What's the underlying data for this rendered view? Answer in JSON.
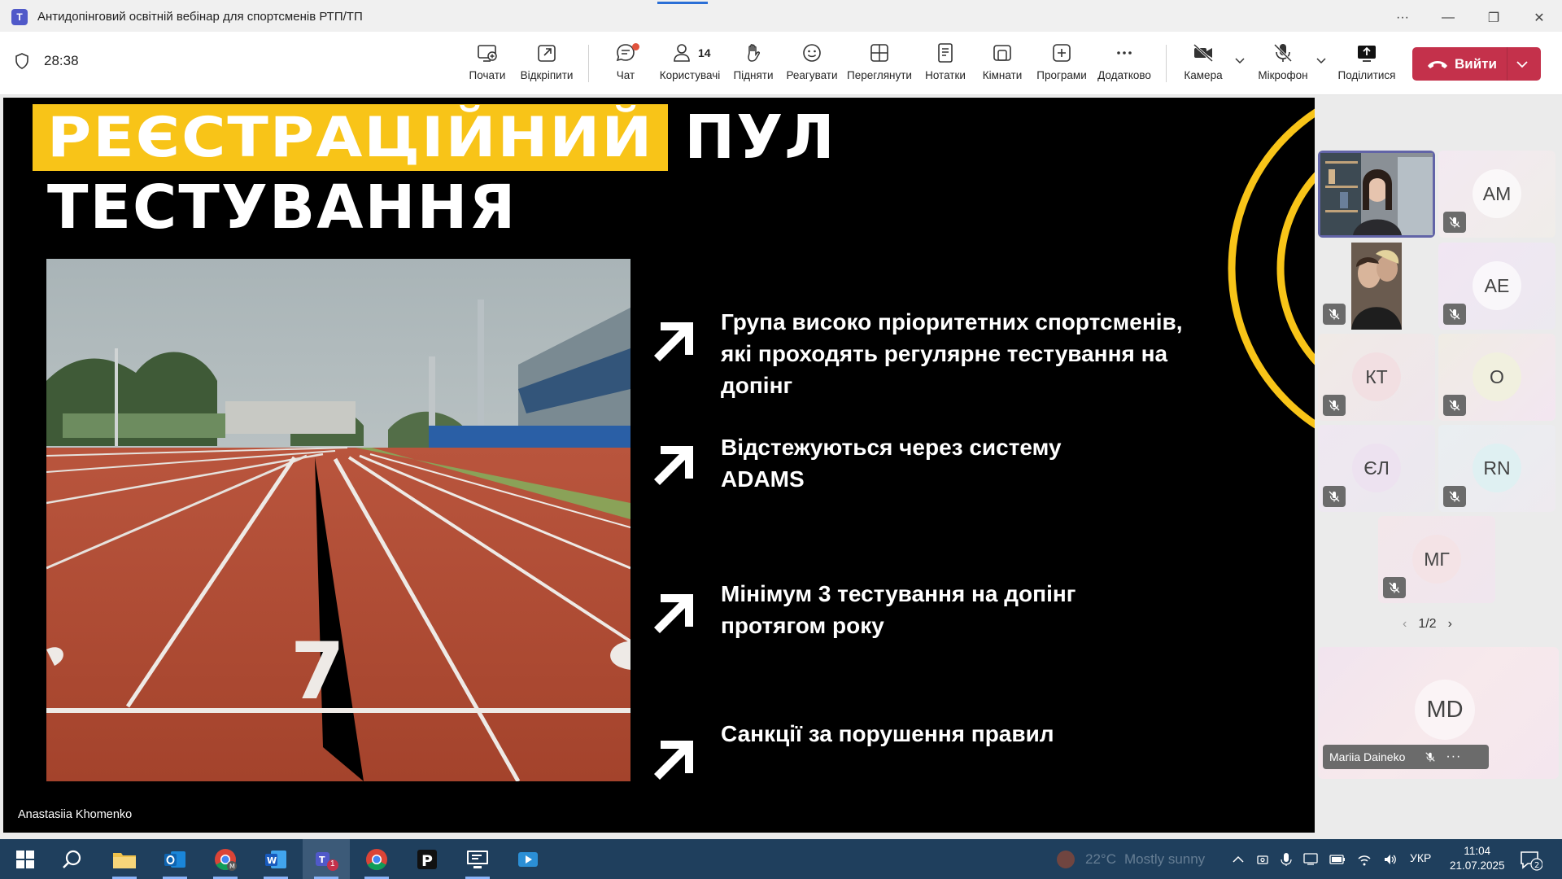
{
  "window": {
    "title": "Антидопінговий освітній вебінар для спортсменів РТП/ТП",
    "app_icon": "teams-icon"
  },
  "toolbar": {
    "timer": "28:38",
    "start_label": "Почати",
    "popout_label": "Відкріпити",
    "chat_label": "Чат",
    "people_label": "Користувачі",
    "people_count": "14",
    "raise_label": "Підняти",
    "react_label": "Реагувати",
    "view_label": "Переглянути",
    "notes_label": "Нотатки",
    "rooms_label": "Кімнати",
    "apps_label": "Програми",
    "more_label": "Додатково",
    "camera_label": "Камера",
    "mic_label": "Мікрофон",
    "share_label": "Поділитися",
    "leave_label": "Вийти",
    "leave_color": "#c4314b"
  },
  "slide": {
    "title_highlight": "РЕЄСТРАЦІЙНИЙ",
    "title_rest": "ПУЛ",
    "title_line2": "ТЕСТУВАННЯ",
    "accent_color": "#f8c418",
    "photo_lane_number": "7",
    "bullets": [
      "Група високо пріоритетних спортсменів, які проходять регулярне тестування на допінг",
      "Відстежуються через систему ADAMS",
      "Мінімум 3 тестування на допінг протягом року",
      "Санкції за порушення правил"
    ],
    "presenter_name": "Anastasiia Khomenko"
  },
  "participants": {
    "tiles": [
      {
        "initials": "",
        "kind": "video"
      },
      {
        "initials": "AM",
        "kind": "avatar"
      },
      {
        "initials": "",
        "kind": "photo"
      },
      {
        "initials": "AE",
        "kind": "avatar"
      },
      {
        "initials": "КТ",
        "kind": "avatar"
      },
      {
        "initials": "О",
        "kind": "avatar"
      },
      {
        "initials": "ЄЛ",
        "kind": "avatar"
      },
      {
        "initials": "RN",
        "kind": "avatar"
      },
      {
        "initials": "МГ",
        "kind": "avatar"
      }
    ],
    "pager": "1/2",
    "self_initials": "MD",
    "self_name": "Mariia Daineko"
  },
  "taskbar": {
    "weather_temp": "22°C",
    "weather_text": "Mostly sunny",
    "language": "УКР",
    "time": "11:04",
    "date": "21.07.2025",
    "notifications": "2",
    "teams_badge": "1"
  }
}
